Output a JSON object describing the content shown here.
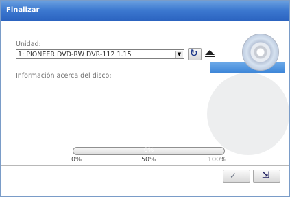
{
  "window": {
    "title": "Finalizar"
  },
  "drive": {
    "label": "Unidad:",
    "selected": "1: PIONEER DVD-RW  DVR-112 1.15",
    "dropdown_icon": "chevron-down-icon",
    "refresh_icon": "refresh-icon",
    "eject_icon": "eject-icon"
  },
  "disc_info": {
    "label": "Información acerca del disco:"
  },
  "progress": {
    "value_percent": 0,
    "text": "0%",
    "ticks": [
      "0%",
      "50%",
      "100%"
    ]
  },
  "buttons": {
    "ok_icon": "checkmark-icon",
    "exit_icon": "exit-icon"
  },
  "colors": {
    "title_bar": "#3d79d0",
    "accent": "#6aa8e8"
  }
}
